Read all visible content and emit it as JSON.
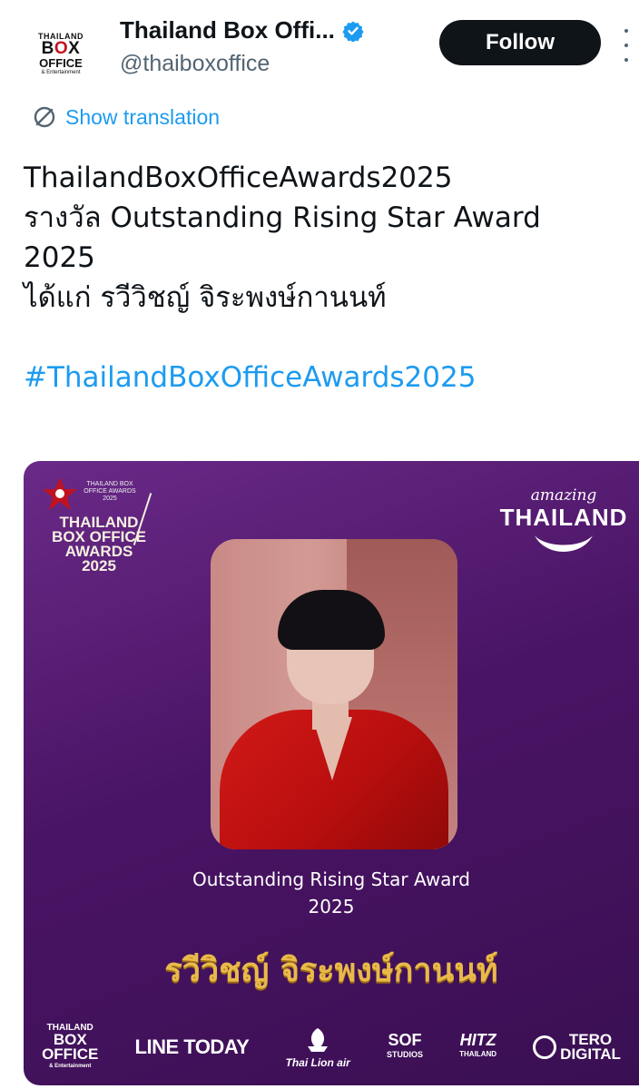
{
  "header": {
    "avatar": {
      "line1": "THAILAND",
      "line2a": "B",
      "line2b": "O",
      "line2c": "X",
      "line3": "OFFICE",
      "line4": "& Entertainment"
    },
    "display_name": "Thailand Box Offi...",
    "handle": "@thaiboxoffice",
    "follow_label": "Follow",
    "verified_icon": "verified-badge-icon",
    "more_icon": "more-options-icon"
  },
  "translation": {
    "label": "Show translation",
    "icon": "translate-icon"
  },
  "tweet": {
    "lines": [
      "ThailandBoxOfficeAwards2025",
      "รางวัล Outstanding Rising Star Award",
      "2025",
      "ได้แก่ รวีวิชญ์ จิระพงษ์กานนท์"
    ],
    "hashtag": "#ThailandBoxOfficeAwards2025"
  },
  "media": {
    "logo": {
      "small_text": "THAILAND BOX OFFICE AWARDS 2025",
      "title_lines": [
        "THAILAND",
        "BOX OFFICE",
        "AWARDS",
        "2025"
      ]
    },
    "amazing": {
      "line1": "amazing",
      "line2": "THAILAND"
    },
    "award_line1": "Outstanding Rising Star Award",
    "award_line2": "2025",
    "winner_name": "รวีวิชญ์ จิระพงษ์กานนท์",
    "sponsors": {
      "tbo": {
        "top": "THAILAND",
        "big1": "BOX",
        "big2": "OFFICE",
        "bottom": "& Entertainment"
      },
      "line_today": "LINE TODAY",
      "thai_lion": "Thai Lion air",
      "sof": {
        "main": "SOF",
        "sub": "STUDIOS"
      },
      "hitz": {
        "main": "HITZ",
        "sub": "THAILAND"
      },
      "tero": {
        "line1": "TERO",
        "line2": "DIGITAL"
      }
    }
  },
  "colors": {
    "accent": "#1d9bf0",
    "text": "#0f1419",
    "muted": "#536471",
    "media_bg": "#4a1465",
    "winner_gold": "#e9b94a"
  }
}
